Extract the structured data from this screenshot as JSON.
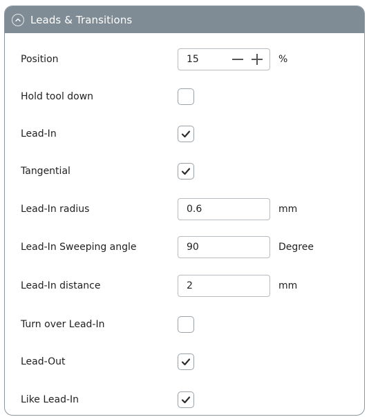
{
  "panel": {
    "title": "Leads & Transitions",
    "collapse_icon": "chevron-up-circle-icon"
  },
  "position": {
    "label": "Position",
    "value": "15",
    "unit": "%",
    "minus_icon": "minus-icon",
    "plus_icon": "plus-icon"
  },
  "hold_tool_down": {
    "label": "Hold tool down",
    "checked": false
  },
  "lead_in": {
    "label": "Lead-In",
    "checked": true
  },
  "tangential": {
    "label": "Tangential",
    "checked": true
  },
  "lead_in_radius": {
    "label": "Lead-In radius",
    "value": "0.6",
    "unit": "mm"
  },
  "lead_in_sweeping_angle": {
    "label": "Lead-In Sweeping angle",
    "value": "90",
    "unit": "Degree"
  },
  "lead_in_distance": {
    "label": "Lead-In distance",
    "value": "2",
    "unit": "mm"
  },
  "turn_over_lead_in": {
    "label": "Turn over Lead-In",
    "checked": false
  },
  "lead_out": {
    "label": "Lead-Out",
    "checked": true
  },
  "like_lead_in": {
    "label": "Like Lead-In",
    "checked": true
  },
  "colors": {
    "header_bg": "#7f8c95",
    "header_text": "#ffffff",
    "border": "#8a959c",
    "check_mark": "#2b2b2b"
  }
}
